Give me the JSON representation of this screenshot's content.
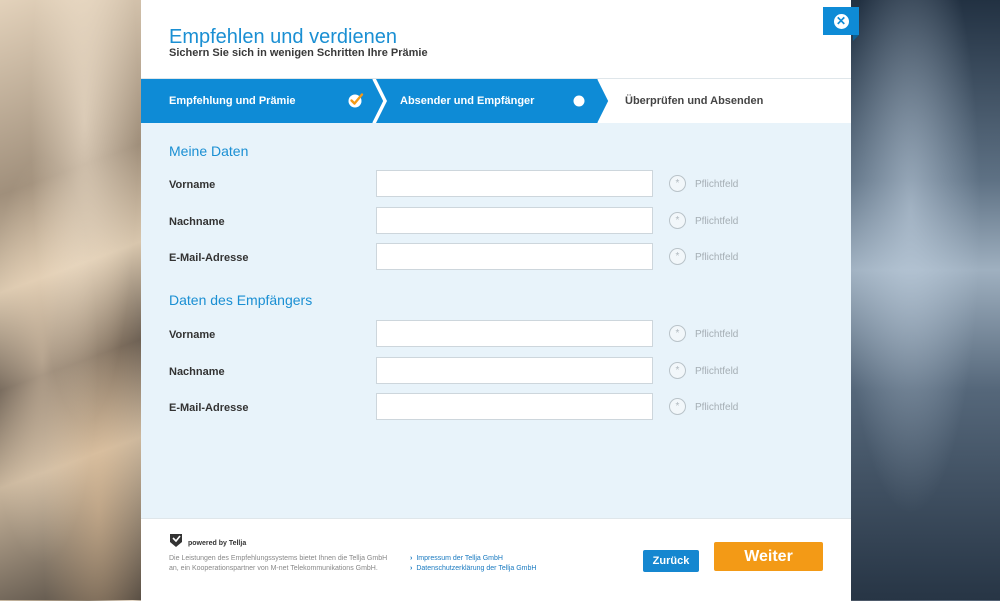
{
  "header": {
    "title": "Empfehlen und verdienen",
    "subtitle": "Sichern Sie sich in wenigen Schritten Ihre Prämie",
    "close_icon": "close-icon"
  },
  "steps": [
    {
      "label": "Empfehlung und Prämie",
      "state": "completed",
      "icon": "checkmark-icon"
    },
    {
      "label": "Absender und Empfänger",
      "state": "active",
      "icon": "dot-icon"
    },
    {
      "label": "Überprüfen und Absenden",
      "state": "upcoming"
    }
  ],
  "sections": [
    {
      "title": "Meine Daten",
      "fields": [
        {
          "label": "Vorname",
          "value": "",
          "required_text": "Pflichtfeld"
        },
        {
          "label": "Nachname",
          "value": "",
          "required_text": "Pflichtfeld"
        },
        {
          "label": "E-Mail-Adresse",
          "value": "",
          "required_text": "Pflichtfeld"
        }
      ]
    },
    {
      "title": "Daten des Empfängers",
      "fields": [
        {
          "label": "Vorname",
          "value": "",
          "required_text": "Pflichtfeld"
        },
        {
          "label": "Nachname",
          "value": "",
          "required_text": "Pflichtfeld"
        },
        {
          "label": "E-Mail-Adresse",
          "value": "",
          "required_text": "Pflichtfeld"
        }
      ]
    }
  ],
  "footer": {
    "powered_by": "powered by Tellja",
    "disclaimer_line1": "Die Leistungen des Empfehlungssystems bietet Ihnen die Tellja GmbH",
    "disclaimer_line2": "an, ein Kooperationspartner von M-net Telekommunikations GmbH.",
    "links": [
      {
        "label": "Impressum der Tellja GmbH"
      },
      {
        "label": "Datenschutzerklärung der Tellja GmbH"
      }
    ],
    "back_label": "Zurück",
    "next_label": "Weiter"
  },
  "colors": {
    "accent": "#1a8fd3",
    "step_active": "#0e8bd6",
    "next_button": "#f39a16",
    "content_bg": "#e8f3fa"
  }
}
